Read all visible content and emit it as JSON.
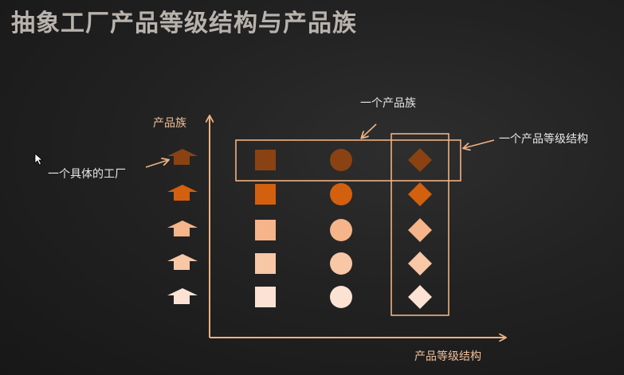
{
  "slide": {
    "title": "抽象工厂产品等级结构与产品族"
  },
  "diagram": {
    "y_axis_label": "产品族",
    "x_axis_label": "产品等级结构",
    "annotation_family": "一个产品族",
    "annotation_level": "一个产品等级结构",
    "annotation_factory": "一个具体的工厂",
    "row_colors": [
      "#8a4212",
      "#d2600e",
      "#f5b48a",
      "#f7c7a6",
      "#fbe2d2"
    ],
    "factory_icon_colors": [
      "#8a4212",
      "#d2600e",
      "#f5b48a",
      "#f7c7a6",
      "#fbe2d2"
    ],
    "shape_columns": [
      "square",
      "circle",
      "diamond"
    ],
    "accent_color": "#f0b182"
  }
}
